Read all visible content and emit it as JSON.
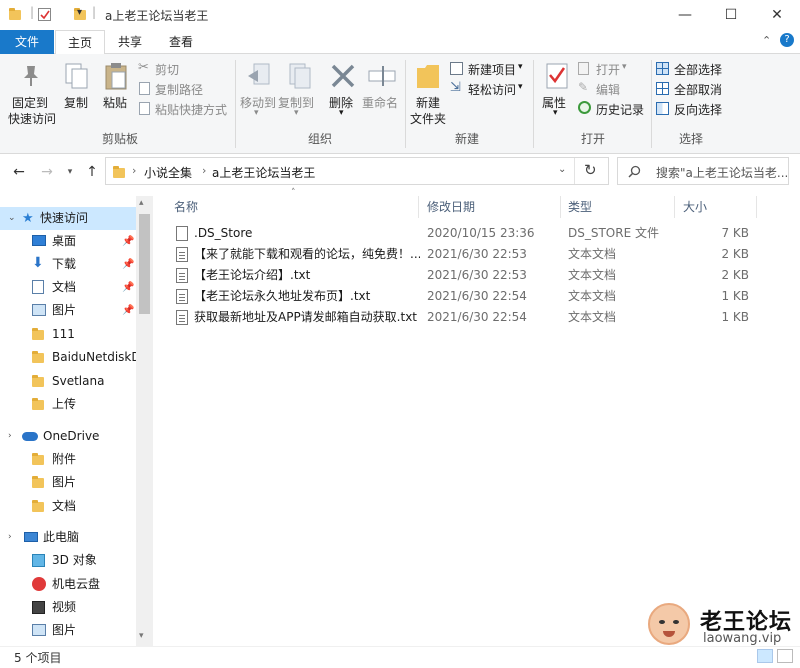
{
  "window": {
    "title": "a上老王论坛当老王",
    "minimize": "—",
    "maximize": "☐",
    "close": "✕"
  },
  "tabs": [
    "文件",
    "主页",
    "共享",
    "查看"
  ],
  "ribbon": {
    "clipboard": {
      "pin": [
        "固定到",
        "快速访问"
      ],
      "copy": "复制",
      "paste": "粘贴",
      "cut": "剪切",
      "copy_path": "复制路径",
      "paste_shortcut": "粘贴快捷方式",
      "label": "剪贴板"
    },
    "organize": {
      "move_to": "移动到",
      "copy_to": "复制到",
      "delete": "删除",
      "rename": "重命名",
      "label": "组织"
    },
    "new": {
      "new_folder": [
        "新建",
        "文件夹"
      ],
      "new_item": "新建项目",
      "easy_access": "轻松访问",
      "label": "新建"
    },
    "open": {
      "properties": "属性",
      "open": "打开",
      "edit": "编辑",
      "history": "历史记录",
      "label": "打开"
    },
    "select": {
      "select_all": "全部选择",
      "select_none": "全部取消",
      "invert": "反向选择",
      "label": "选择"
    }
  },
  "address": {
    "crumbs": [
      "小说全集",
      "a上老王论坛当老王"
    ],
    "search_placeholder": "搜索\"a上老王论坛当老..."
  },
  "nav": {
    "quick_access": "快速访问",
    "items": [
      {
        "label": "桌面",
        "pinned": true
      },
      {
        "label": "下载",
        "pinned": true
      },
      {
        "label": "文档",
        "pinned": true
      },
      {
        "label": "图片",
        "pinned": true
      },
      {
        "label": "111",
        "pinned": false
      },
      {
        "label": "BaiduNetdiskDo",
        "pinned": false
      },
      {
        "label": "Svetlana",
        "pinned": false
      },
      {
        "label": "上传",
        "pinned": false
      }
    ],
    "onedrive": "OneDrive",
    "onedrive_items": [
      "附件",
      "图片",
      "文档"
    ],
    "this_pc": "此电脑",
    "pc_items": [
      "3D 对象",
      "机电云盘",
      "视频",
      "图片"
    ]
  },
  "columns": {
    "name": "名称",
    "date": "修改日期",
    "type": "类型",
    "size": "大小"
  },
  "files": [
    {
      "name": ".DS_Store",
      "date": "2020/10/15 23:36",
      "type": "DS_STORE 文件",
      "size": "7 KB"
    },
    {
      "name": "【来了就能下载和观看的论坛，纯免费！...",
      "date": "2021/6/30 22:53",
      "type": "文本文档",
      "size": "2 KB"
    },
    {
      "name": "【老王论坛介绍】.txt",
      "date": "2021/6/30 22:53",
      "type": "文本文档",
      "size": "2 KB"
    },
    {
      "name": "【老王论坛永久地址发布页】.txt",
      "date": "2021/6/30 22:54",
      "type": "文本文档",
      "size": "1 KB"
    },
    {
      "name": "获取最新地址及APP请发邮箱自动获取.txt",
      "date": "2021/6/30 22:54",
      "type": "文本文档",
      "size": "1 KB"
    }
  ],
  "status": "5 个项目",
  "watermark": {
    "title": "老王论坛",
    "url": "laowang.vip"
  },
  "colors": {
    "file_tab": "#1979ca",
    "folder": "#f2c45a",
    "selection": "#cce8ff"
  }
}
